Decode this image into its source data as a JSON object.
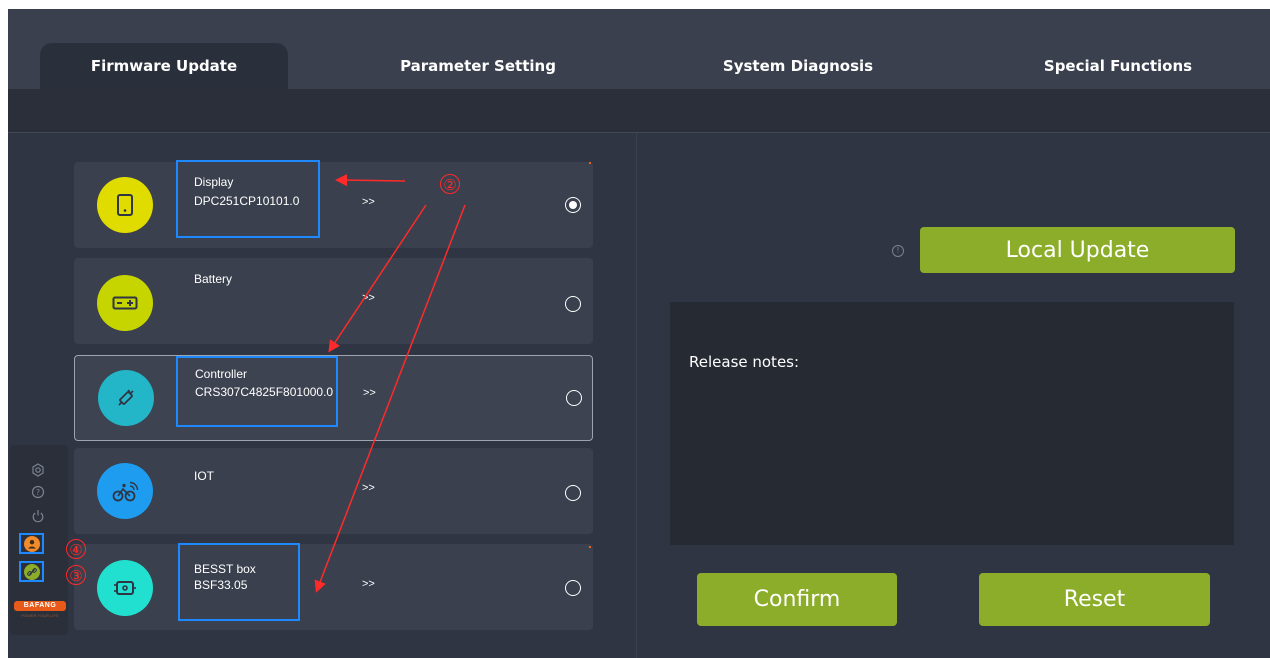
{
  "tabs": [
    {
      "label": "Firmware Update",
      "active": true
    },
    {
      "label": "Parameter Setting",
      "active": false
    },
    {
      "label": "System Diagnosis",
      "active": false
    },
    {
      "label": "Special Functions",
      "active": false
    }
  ],
  "devices": [
    {
      "name": "Display",
      "version": "DPC251CP10101.0",
      "arrow": ">>",
      "selected": true,
      "icon": "display-icon",
      "color": "#e1dc00"
    },
    {
      "name": "Battery",
      "version": "",
      "arrow": ">>",
      "selected": false,
      "icon": "battery-icon",
      "color": "#c6d500"
    },
    {
      "name": "Controller",
      "version": "CRS307C4825F801000.0",
      "arrow": ">>",
      "selected": false,
      "icon": "controller-icon",
      "color": "#22b6c8"
    },
    {
      "name": "IOT",
      "version": "",
      "arrow": ">>",
      "selected": false,
      "icon": "iot-bike-icon",
      "color": "#1e9cf0"
    },
    {
      "name": "BESST box",
      "version": "BSF33.05",
      "arrow": ">>",
      "selected": false,
      "icon": "besst-box-icon",
      "color": "#22e0d0"
    }
  ],
  "right_panel": {
    "local_update_label": "Local Update",
    "release_notes_label": "Release notes:",
    "confirm_label": "Confirm",
    "reset_label": "Reset"
  },
  "sidebar": {
    "icons": [
      "settings-icon",
      "help-icon",
      "power-icon"
    ],
    "user_icon": "user-icon",
    "link_icon": "link-icon",
    "brand": "BAFANG",
    "brand_tagline": "POWER YOUR LIFE"
  },
  "annotations": {
    "callout_2": "②",
    "callout_3": "③",
    "callout_4": "④"
  },
  "colors": {
    "accent_green": "#8cad2a",
    "highlight_blue": "#1e88ff",
    "annotation_red": "#ff2a2a",
    "brand_orange": "#e85a1a"
  }
}
